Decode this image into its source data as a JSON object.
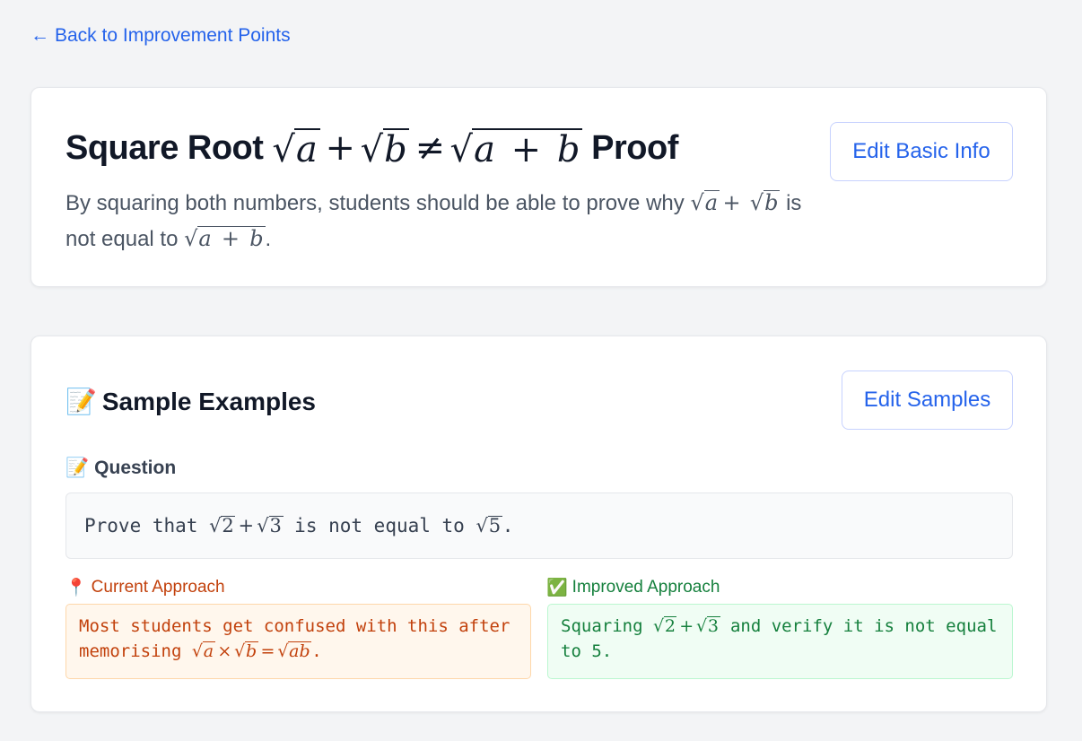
{
  "nav": {
    "back_label": "Back to Improvement Points",
    "back_arrow": "←"
  },
  "basic": {
    "title_prefix": "Square Root",
    "title_suffix": "Proof",
    "desc_part1": "By squaring both numbers, students should be able to prove why",
    "desc_part2": "is not equal to",
    "edit_label": "Edit Basic Info"
  },
  "samples": {
    "section_title": "Sample Examples",
    "section_icon": "📝",
    "edit_label": "Edit Samples",
    "question_icon": "📝",
    "question_label": "Question",
    "question_text_1": "Prove that",
    "question_text_2": "is not equal to",
    "current_icon": "📍",
    "current_label": "Current Approach",
    "current_text_1": "Most students get confused with this after memorising",
    "improved_icon": "✅",
    "improved_label": "Improved Approach",
    "improved_text_1": "Squaring",
    "improved_text_2": "and verify it is not equal to 5."
  },
  "colors": {
    "accent": "#2563eb",
    "current": "#c2410c",
    "improved": "#15803d"
  }
}
